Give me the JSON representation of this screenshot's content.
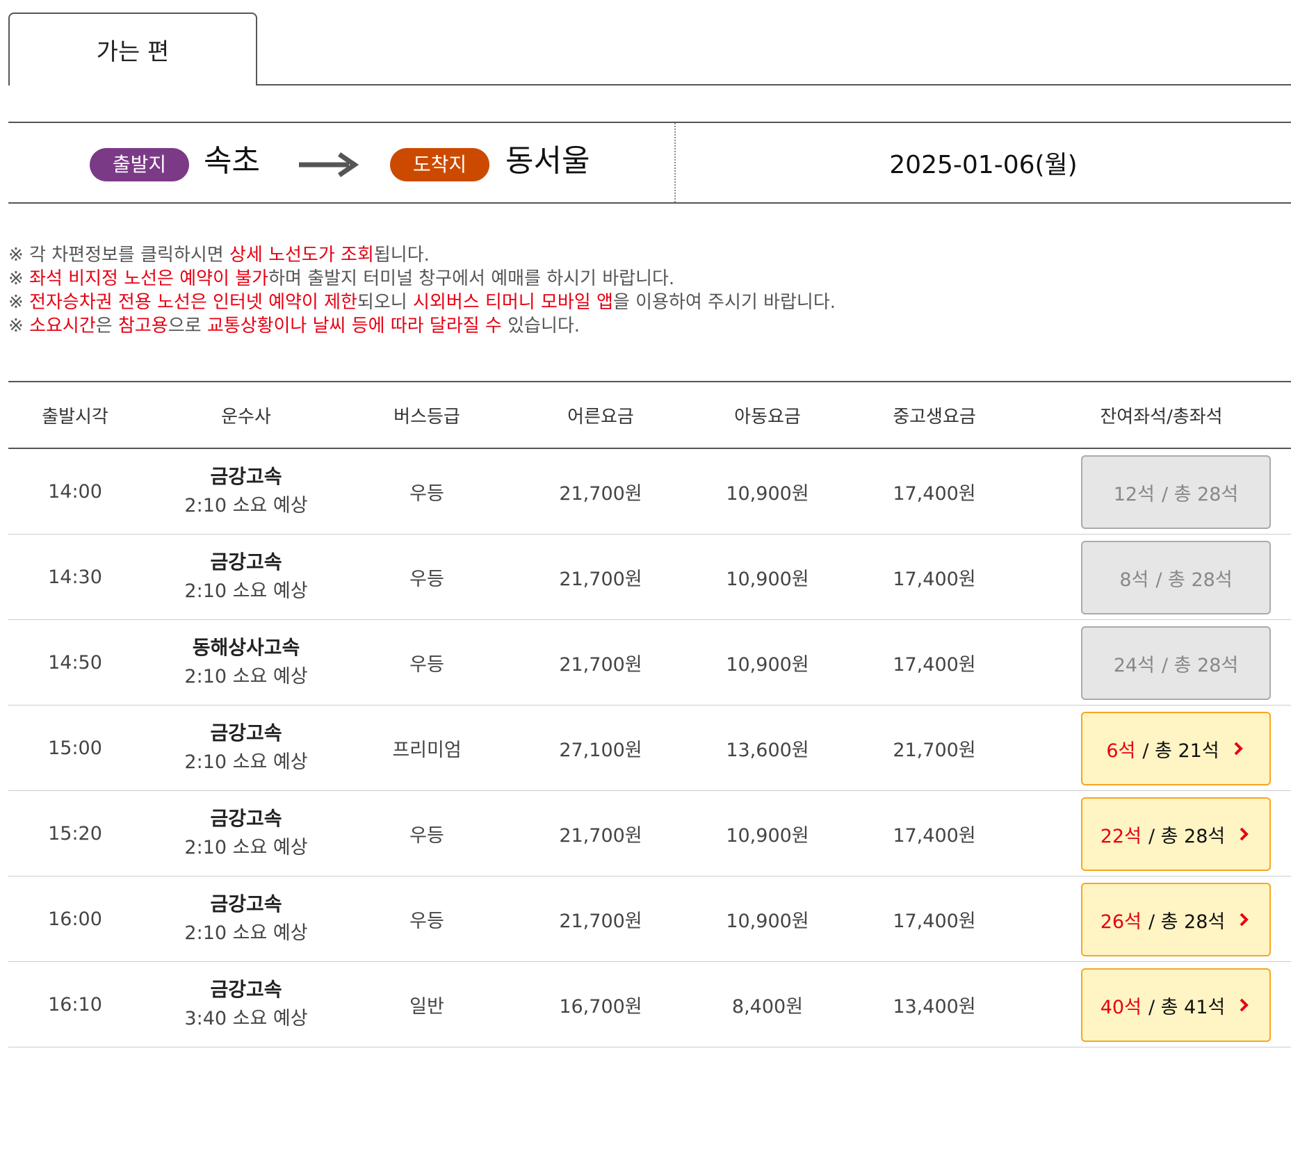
{
  "tab": {
    "label": "가는 편"
  },
  "route": {
    "departure_label": "출발지",
    "departure_city": "속초",
    "arrival_label": "도착지",
    "arrival_city": "동서울",
    "date": "2025-01-06(월)"
  },
  "notices": [
    [
      {
        "t": "※ 각 차편정보를 클릭하시면 ",
        "red": false
      },
      {
        "t": "상세 노선도가 조회",
        "red": true
      },
      {
        "t": "됩니다.",
        "red": false
      }
    ],
    [
      {
        "t": "※ ",
        "red": false
      },
      {
        "t": "좌석 비지정 노선은 예약이 불가",
        "red": true
      },
      {
        "t": "하며 출발지 터미널 창구에서 예매를 하시기 바랍니다.",
        "red": false
      }
    ],
    [
      {
        "t": "※ ",
        "red": false
      },
      {
        "t": "전자승차권 전용 노선은 인터넷 예약이 제한",
        "red": true
      },
      {
        "t": "되오니 ",
        "red": false
      },
      {
        "t": "시외버스 티머니 모바일 앱",
        "red": true
      },
      {
        "t": "을 이용하여 주시기 바랍니다.",
        "red": false
      }
    ],
    [
      {
        "t": "※ ",
        "red": false
      },
      {
        "t": "소요시간",
        "red": true
      },
      {
        "t": "은 ",
        "red": false
      },
      {
        "t": "참고용",
        "red": true
      },
      {
        "t": "으로 ",
        "red": false
      },
      {
        "t": "교통상황이나 날씨 등에 따라 달라질 수",
        "red": true
      },
      {
        "t": " 있습니다.",
        "red": false
      }
    ]
  ],
  "table": {
    "headers": [
      "출발시각",
      "운수사",
      "버스등급",
      "어른요금",
      "아동요금",
      "중고생요금",
      "잔여좌석/총좌석"
    ],
    "rows": [
      {
        "time": "14:00",
        "company": "금강고속",
        "duration": "2:10 소요 예상",
        "grade": "우등",
        "adult": "21,700원",
        "child": "10,900원",
        "teen": "17,400원",
        "remaining": "12석",
        "total": "/ 총 28석",
        "available": false
      },
      {
        "time": "14:30",
        "company": "금강고속",
        "duration": "2:10 소요 예상",
        "grade": "우등",
        "adult": "21,700원",
        "child": "10,900원",
        "teen": "17,400원",
        "remaining": "8석",
        "total": "/ 총 28석",
        "available": false
      },
      {
        "time": "14:50",
        "company": "동해상사고속",
        "duration": "2:10 소요 예상",
        "grade": "우등",
        "adult": "21,700원",
        "child": "10,900원",
        "teen": "17,400원",
        "remaining": "24석",
        "total": "/ 총 28석",
        "available": false
      },
      {
        "time": "15:00",
        "company": "금강고속",
        "duration": "2:10 소요 예상",
        "grade": "프리미엄",
        "adult": "27,100원",
        "child": "13,600원",
        "teen": "21,700원",
        "remaining": "6석",
        "total": "/ 총 21석",
        "available": true
      },
      {
        "time": "15:20",
        "company": "금강고속",
        "duration": "2:10 소요 예상",
        "grade": "우등",
        "adult": "21,700원",
        "child": "10,900원",
        "teen": "17,400원",
        "remaining": "22석",
        "total": "/ 총 28석",
        "available": true
      },
      {
        "time": "16:00",
        "company": "금강고속",
        "duration": "2:10 소요 예상",
        "grade": "우등",
        "adult": "21,700원",
        "child": "10,900원",
        "teen": "17,400원",
        "remaining": "26석",
        "total": "/ 총 28석",
        "available": true
      },
      {
        "time": "16:10",
        "company": "금강고속",
        "duration": "3:40 소요 예상",
        "grade": "일반",
        "adult": "16,700원",
        "child": "8,400원",
        "teen": "13,400원",
        "remaining": "40석",
        "total": "/ 총 41석",
        "available": true
      }
    ]
  },
  "colors": {
    "departure_pill": "#7b3a86",
    "arrival_pill": "#cc4a00",
    "notice_highlight": "#e60012",
    "seat_available_bg": "#fff4c4",
    "seat_available_border": "#f5a623",
    "seat_disabled_bg": "#e6e6e6"
  },
  "icons": {
    "route_arrow": "long-right-arrow-icon",
    "seat_chevron": "chevron-right-icon"
  }
}
